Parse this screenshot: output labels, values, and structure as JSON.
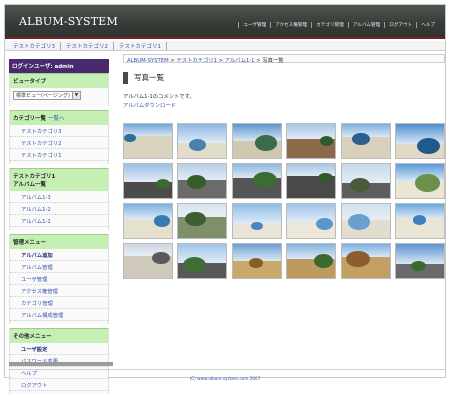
{
  "header": {
    "logo": "ALBUM-SYSTEM",
    "nav": [
      "ユーザ管理",
      "アクセス権管理",
      "カテゴリ管理",
      "アルバム管理",
      "ログアウト",
      "ヘルプ"
    ]
  },
  "subnav": [
    "テストカテゴリ3",
    "テストカテゴリ2",
    "テストカテゴリ1"
  ],
  "sidebar": {
    "login_user": "ログインユーザ: admin",
    "view_type": {
      "heading": "ビュータイプ",
      "selected": "標準ビュー(ページング)"
    },
    "category_list": {
      "heading": "カテゴリ一覧",
      "heading_link": "一覧へ",
      "items": [
        "テストカテゴリ3",
        "テストカテゴリ2",
        "テストカテゴリ1"
      ]
    },
    "album_list": {
      "heading_line1": "テストカテゴリ1",
      "heading_line2": "アルバム一覧",
      "items": [
        "アルバム1-3",
        "アルバム1-2",
        "アルバム1-1"
      ]
    },
    "admin_menu": {
      "heading": "管理メニュー",
      "items": [
        "アルバム追加",
        "アルバム管理",
        "ユーザ管理",
        "アクセス権管理",
        "カテゴリ管理",
        "アルバム構成管理"
      ]
    },
    "other_menu": {
      "heading": "その他メニュー",
      "items": [
        "ユーザ設定",
        "パスワード変更",
        "ヘルプ",
        "ログアウト"
      ]
    }
  },
  "main": {
    "breadcrumb": [
      "ALBUM-SYSTEM",
      "テストカテゴリ1",
      "アルバム1-1",
      "写真一覧"
    ],
    "separator": " > ",
    "title": "写真一覧",
    "description": "アルバム1-1のコメントです。",
    "download_link": "アルバムダウンロード"
  },
  "photos": [
    {
      "sky": "#6fa6d8",
      "ground": "#d9d2bf",
      "accent": "#2f6e9a"
    },
    {
      "sky": "#8db8e2",
      "ground": "#e2dccb",
      "accent": "#4b7fae"
    },
    {
      "sky": "#5d95cf",
      "ground": "#cfc7b0",
      "accent": "#3a6b4a"
    },
    {
      "sky": "#a9c6e4",
      "ground": "#8b6b4a",
      "accent": "#2f5a2f"
    },
    {
      "sky": "#7fb0df",
      "ground": "#d8d0bc",
      "accent": "#2c5f8e"
    },
    {
      "sky": "#4f8fd0",
      "ground": "#e0d9c6",
      "accent": "#1f5a8a"
    },
    {
      "sky": "#9cc0e3",
      "ground": "#4b4b4b",
      "accent": "#3c6a2c"
    },
    {
      "sky": "#b8cfe6",
      "ground": "#6b6b6b",
      "accent": "#355e2a"
    },
    {
      "sky": "#8fb7de",
      "ground": "#555555",
      "accent": "#3d6b34"
    },
    {
      "sky": "#a8c4e2",
      "ground": "#4a4a4a",
      "accent": "#2e5a27"
    },
    {
      "sky": "#c6d8ea",
      "ground": "#5e5e5e",
      "accent": "#4a5a3a"
    },
    {
      "sky": "#5a9ad6",
      "ground": "#ebe5d4",
      "accent": "#6c8f4a"
    },
    {
      "sky": "#7eb1e1",
      "ground": "#e6e0cf",
      "accent": "#3779b5"
    },
    {
      "sky": "#d9e3ec",
      "ground": "#7f8f6a",
      "accent": "#3d5e2e"
    },
    {
      "sky": "#8ebde6",
      "ground": "#e9e4d6",
      "accent": "#4a86c0"
    },
    {
      "sky": "#9fc6ea",
      "ground": "#ece7da",
      "accent": "#5c95c9"
    },
    {
      "sky": "#cfe0ef",
      "ground": "#e3ddd0",
      "accent": "#6aa0d0"
    },
    {
      "sky": "#6aa8de",
      "ground": "#eae4d4",
      "accent": "#3d7fbf"
    },
    {
      "sky": "#cfd8e0",
      "ground": "#cfc9bb",
      "accent": "#5a5a5a"
    },
    {
      "sky": "#9fc4e6",
      "ground": "#585858",
      "accent": "#3f6d35"
    },
    {
      "sky": "#6f9fd0",
      "ground": "#c9a86a",
      "accent": "#8a5a2a"
    },
    {
      "sky": "#86b2de",
      "ground": "#bf9a5e",
      "accent": "#3c6a2e"
    },
    {
      "sky": "#7aaee0",
      "ground": "#c49f63",
      "accent": "#8c5d2f"
    },
    {
      "sky": "#5b93cf",
      "ground": "#6a6a6a",
      "accent": "#3a6a2e"
    }
  ],
  "footer": "(C) www.album-system.com 2007"
}
